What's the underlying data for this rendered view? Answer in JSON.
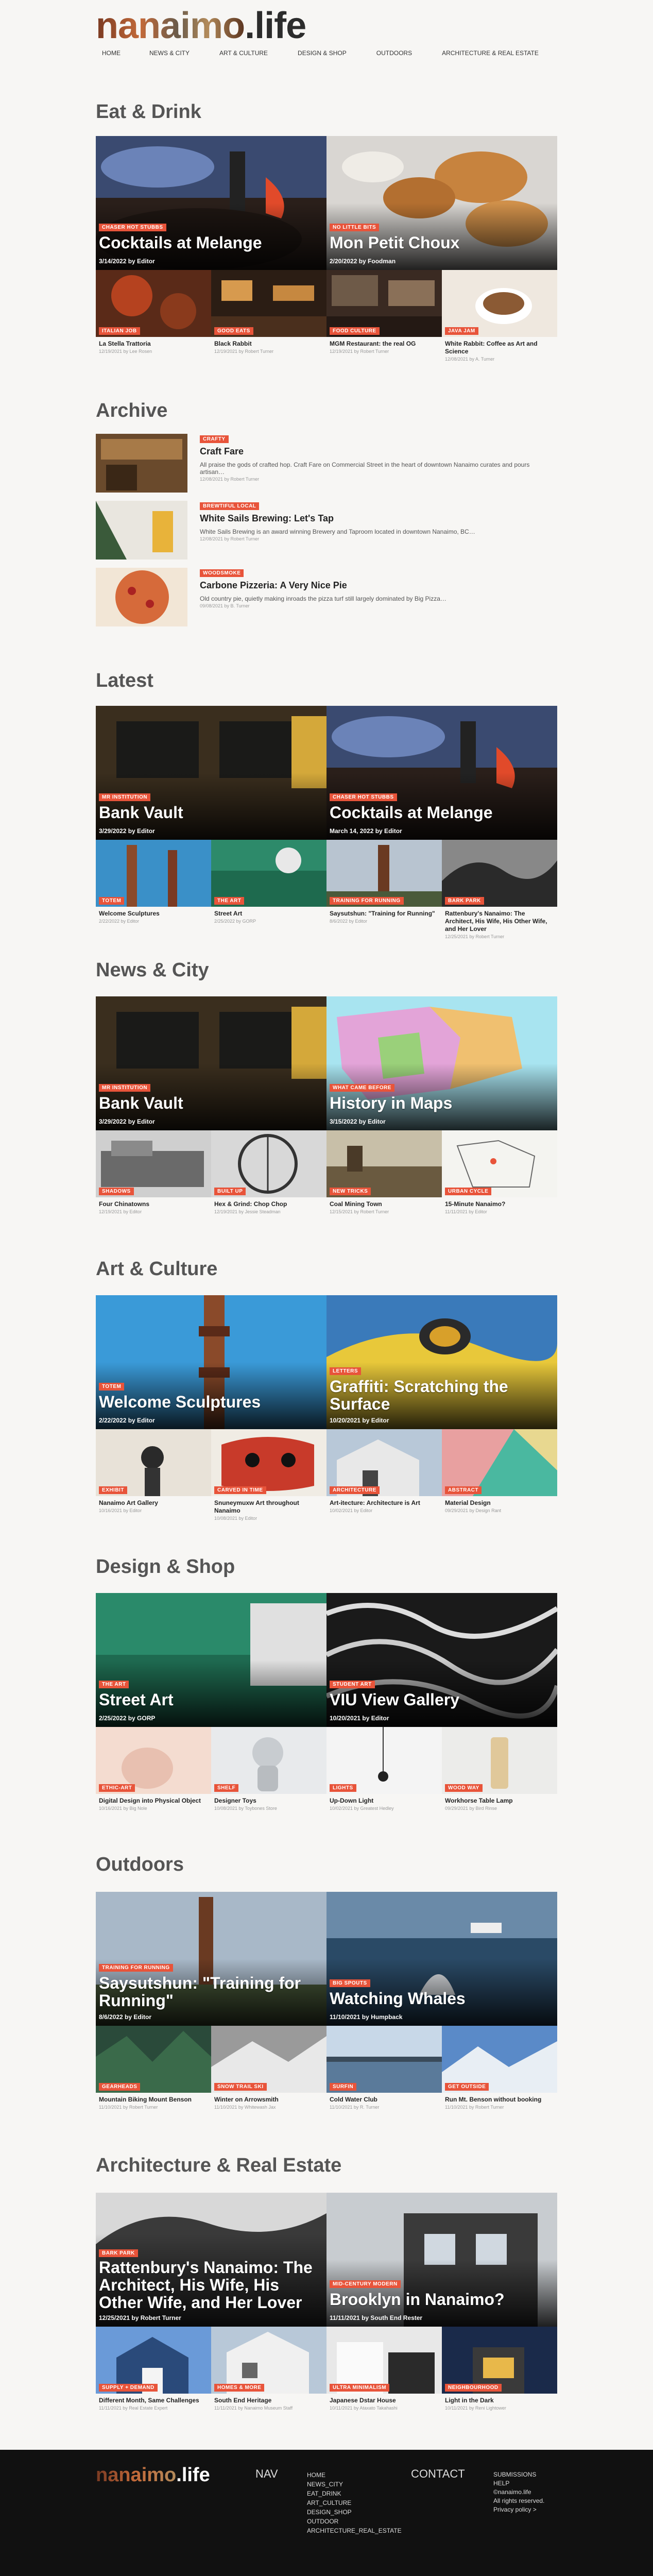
{
  "site": {
    "logo_main": "nanaimo",
    "logo_dot": ".",
    "logo_life": "life"
  },
  "nav": [
    "HOME",
    "NEWS & CITY",
    "ART & CULTURE",
    "DESIGN & SHOP",
    "OUTDOORS",
    "ARCHITECTURE & REAL ESTATE"
  ],
  "sections": {
    "eat": {
      "title": "Eat & Drink",
      "features": [
        {
          "tag": "CHASER HOT STUBBS",
          "title": "Cocktails at Melange",
          "meta": "3/14/2022 by Editor"
        },
        {
          "tag": "NO LITTLE BITS",
          "title": "Mon Petit Choux",
          "meta": "2/20/2022 by Foodman"
        }
      ],
      "smalls": [
        {
          "tag": "ITALIAN JOB",
          "title": "La Stella Trattoria",
          "meta": "12/19/2021 by Lee Rosen"
        },
        {
          "tag": "GOOD EATS",
          "title": "Black Rabbit",
          "meta": "12/19/2021 by Robert Turner"
        },
        {
          "tag": "FOOD CULTURE",
          "title": "MGM Restaurant: the real OG",
          "meta": "12/19/2021 by Robert Turner"
        },
        {
          "tag": "JAVA JAM",
          "title": "White Rabbit: Coffee as Art and Science",
          "meta": "12/08/2021 by A. Turner"
        }
      ]
    },
    "archive": {
      "title": "Archive",
      "items": [
        {
          "tag": "CRAFTY",
          "title": "Craft Fare",
          "excerpt": "All praise the gods of crafted hop. Craft Fare on Commercial Street in the heart of downtown Nanaimo curates and pours artisan…",
          "meta": "12/08/2021 by Robert Turner"
        },
        {
          "tag": "BREWTIFUL LOCAL",
          "title": "White Sails Brewing: Let's Tap",
          "excerpt": "White Sails Brewing is an award winning Brewery and Taproom located in downtown Nanaimo, BC…",
          "meta": "12/08/2021 by Robert Turner"
        },
        {
          "tag": "WOODSMOKE",
          "title": "Carbone Pizzeria: A Very Nice Pie",
          "excerpt": "Old country pie, quietly making inroads the pizza turf still largely dominated by Big Pizza…",
          "meta": "09/08/2021 by B. Turner"
        }
      ]
    },
    "latest": {
      "title": "Latest",
      "features": [
        {
          "tag": "MR INSTITUTION",
          "title": "Bank Vault",
          "meta": "3/29/2022 by Editor"
        },
        {
          "tag": "CHASER HOT STUBBS",
          "title": "Cocktails at Melange",
          "meta": "March 14, 2022 by Editor"
        }
      ],
      "smalls": [
        {
          "tag": "TOTEM",
          "title": "Welcome Sculptures",
          "meta": "2/22/2022 by Editor"
        },
        {
          "tag": "THE ART",
          "title": "Street Art",
          "meta": "2/25/2022 by GORP"
        },
        {
          "tag": "TRAINING FOR RUNNING",
          "title": "Saysutshun: \"Training for Running\"",
          "meta": "8/6/2022 by Editor"
        },
        {
          "tag": "BARK PARK",
          "title": "Rattenbury's Nanaimo: The Architect, His Wife, His Other Wife, and Her Lover",
          "meta": "12/25/2021 by Robert Turner"
        }
      ]
    },
    "news": {
      "title": "News & City",
      "features": [
        {
          "tag": "MR INSTITUTION",
          "title": "Bank Vault",
          "meta": "3/29/2022 by Editor"
        },
        {
          "tag": "WHAT CAME BEFORE",
          "title": "History in Maps",
          "meta": "3/15/2022 by Editor"
        }
      ],
      "smalls": [
        {
          "tag": "SHADOWS",
          "title": "Four Chinatowns",
          "meta": "12/19/2021 by Editor"
        },
        {
          "tag": "BUILT UP",
          "title": "Hex & Grind: Chop Chop",
          "meta": "12/19/2021 by Jessie Steadman"
        },
        {
          "tag": "NEW TRICKS",
          "title": "Coal Mining Town",
          "meta": "12/15/2021 by Robert Turner"
        },
        {
          "tag": "URBAN CYCLE",
          "title": "15-Minute Nanaimo?",
          "meta": "11/11/2021 by Editor"
        }
      ]
    },
    "art": {
      "title": "Art & Culture",
      "features": [
        {
          "tag": "TOTEM",
          "title": "Welcome Sculptures",
          "meta": "2/22/2022 by Editor"
        },
        {
          "tag": "LETTERS",
          "title": "Graffiti: Scratching the Surface",
          "meta": "10/20/2021 by Editor"
        }
      ],
      "smalls": [
        {
          "tag": "EXHIBIT",
          "title": "Nanaimo Art Gallery",
          "meta": "10/16/2021 by Editor"
        },
        {
          "tag": "CARVED IN TIME",
          "title": "Snuneymuxw Art throughout Nanaimo",
          "meta": "10/08/2021 by Editor"
        },
        {
          "tag": "ARCHITECTURE",
          "title": "Art-itecture: Architecture is Art",
          "meta": "10/02/2021 by Editor"
        },
        {
          "tag": "ABSTRACT",
          "title": "Material Design",
          "meta": "09/29/2021 by Design Rant"
        }
      ]
    },
    "design": {
      "title": "Design & Shop",
      "features": [
        {
          "tag": "THE ART",
          "title": "Street Art",
          "meta": "2/25/2022 by GORP"
        },
        {
          "tag": "STUDENT ART",
          "title": "VIU View Gallery",
          "meta": "10/20/2021 by Editor"
        }
      ],
      "smalls": [
        {
          "tag": "ETHIC-ART",
          "title": "Digital Design into Physical Object",
          "meta": "10/16/2021 by Big Nole"
        },
        {
          "tag": "SHELF",
          "title": "Designer Toys",
          "meta": "10/08/2021 by Toybones Store"
        },
        {
          "tag": "LIGHTS",
          "title": "Up-Down Light",
          "meta": "10/02/2021 by Greatest Hedley"
        },
        {
          "tag": "WOOD WAY",
          "title": "Workhorse Table Lamp",
          "meta": "09/29/2021 by Bird Rinse"
        }
      ]
    },
    "outdoors": {
      "title": "Outdoors",
      "features": [
        {
          "tag": "TRAINING FOR RUNNING",
          "title": "Saysutshun: \"Training for Running\"",
          "meta": "8/6/2022 by Editor"
        },
        {
          "tag": "BIG SPOUTS",
          "title": "Watching Whales",
          "meta": "11/10/2021 by Humpback"
        }
      ],
      "smalls": [
        {
          "tag": "GEARHEADS",
          "title": "Mountain Biking Mount Benson",
          "meta": "11/10/2021 by Robert Turner"
        },
        {
          "tag": "SNOW TRAIL SKI",
          "title": "Winter on Arrowsmith",
          "meta": "11/10/2021 by Whitewash Jax"
        },
        {
          "tag": "SURFIN",
          "title": "Cold Water Club",
          "meta": "11/10/2021 by R. Turner"
        },
        {
          "tag": "GET OUTSIDE",
          "title": "Run Mt. Benson without booking",
          "meta": "11/10/2021 by Robert Turner"
        }
      ]
    },
    "arch": {
      "title": "Architecture & Real Estate",
      "features": [
        {
          "tag": "BARK PARK",
          "title": "Rattenbury's Nanaimo: The Architect, His Wife, His Other Wife, and Her Lover",
          "meta": "12/25/2021 by Robert Turner"
        },
        {
          "tag": "MID-CENTURY MODERN",
          "title": "Brooklyn in Nanaimo?",
          "meta": "11/11/2021 by South End Rester"
        }
      ],
      "smalls": [
        {
          "tag": "SUPPLY + DEMAND",
          "title": "Different Month, Same Challenges",
          "meta": "11/11/2021 by Real Estate Expert"
        },
        {
          "tag": "HOMES & MORE",
          "title": "South End Heritage",
          "meta": "11/11/2021 by Nanaimo Museum Staff"
        },
        {
          "tag": "ULTRA MINIMALISM",
          "title": "Japanese Dstar House",
          "meta": "10/11/2021 by Ataxato Takahashi"
        },
        {
          "tag": "NEIGHBOURHOOD",
          "title": "Light in the Dark",
          "meta": "10/11/2021 by Reni Lightower"
        }
      ]
    }
  },
  "footer": {
    "nav_heading": "NAV",
    "nav_links": [
      "HOME",
      "NEWS_CITY",
      "EAT_DRINK",
      "ART_CULTURE",
      "DESIGN_SHOP",
      "OUTDOOR",
      "ARCHITECTURE_REAL_ESTATE"
    ],
    "contact_heading": "CONTACT",
    "contact_links": [
      "SUBMISSIONS",
      "HELP"
    ],
    "copyright": "©nanaimo.life",
    "rights": "All rights reserved.",
    "privacy": "Privacy policy >"
  },
  "colors": {
    "accent": "#e8543a",
    "footer_bg": "#111111",
    "page_bg": "#f7f6f4"
  }
}
